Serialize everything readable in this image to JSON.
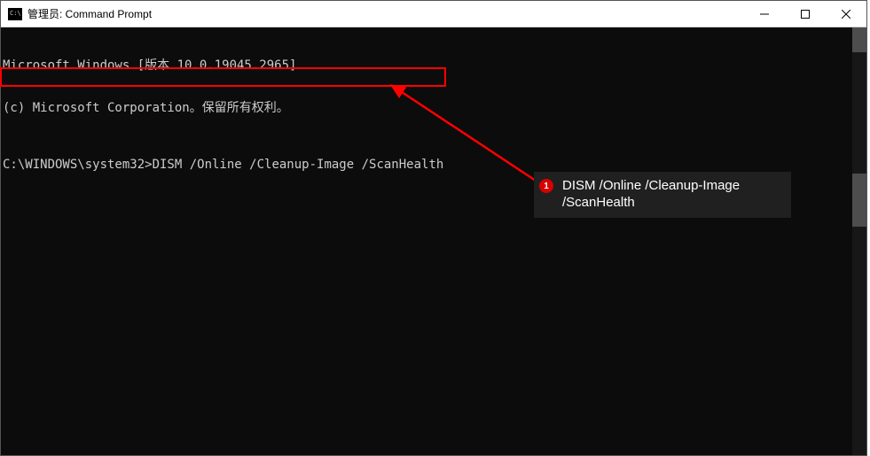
{
  "titlebar": {
    "title": "管理员: Command Prompt"
  },
  "terminal": {
    "line1": "Microsoft Windows [版本 10.0.19045.2965]",
    "line2": "(c) Microsoft Corporation。保留所有权利。",
    "prompt": "C:\\WINDOWS\\system32>",
    "command": "DISM /Online /Cleanup-Image /ScanHealth"
  },
  "annotation": {
    "badge": "1",
    "text": "DISM /Online /Cleanup-Image /ScanHealth"
  }
}
